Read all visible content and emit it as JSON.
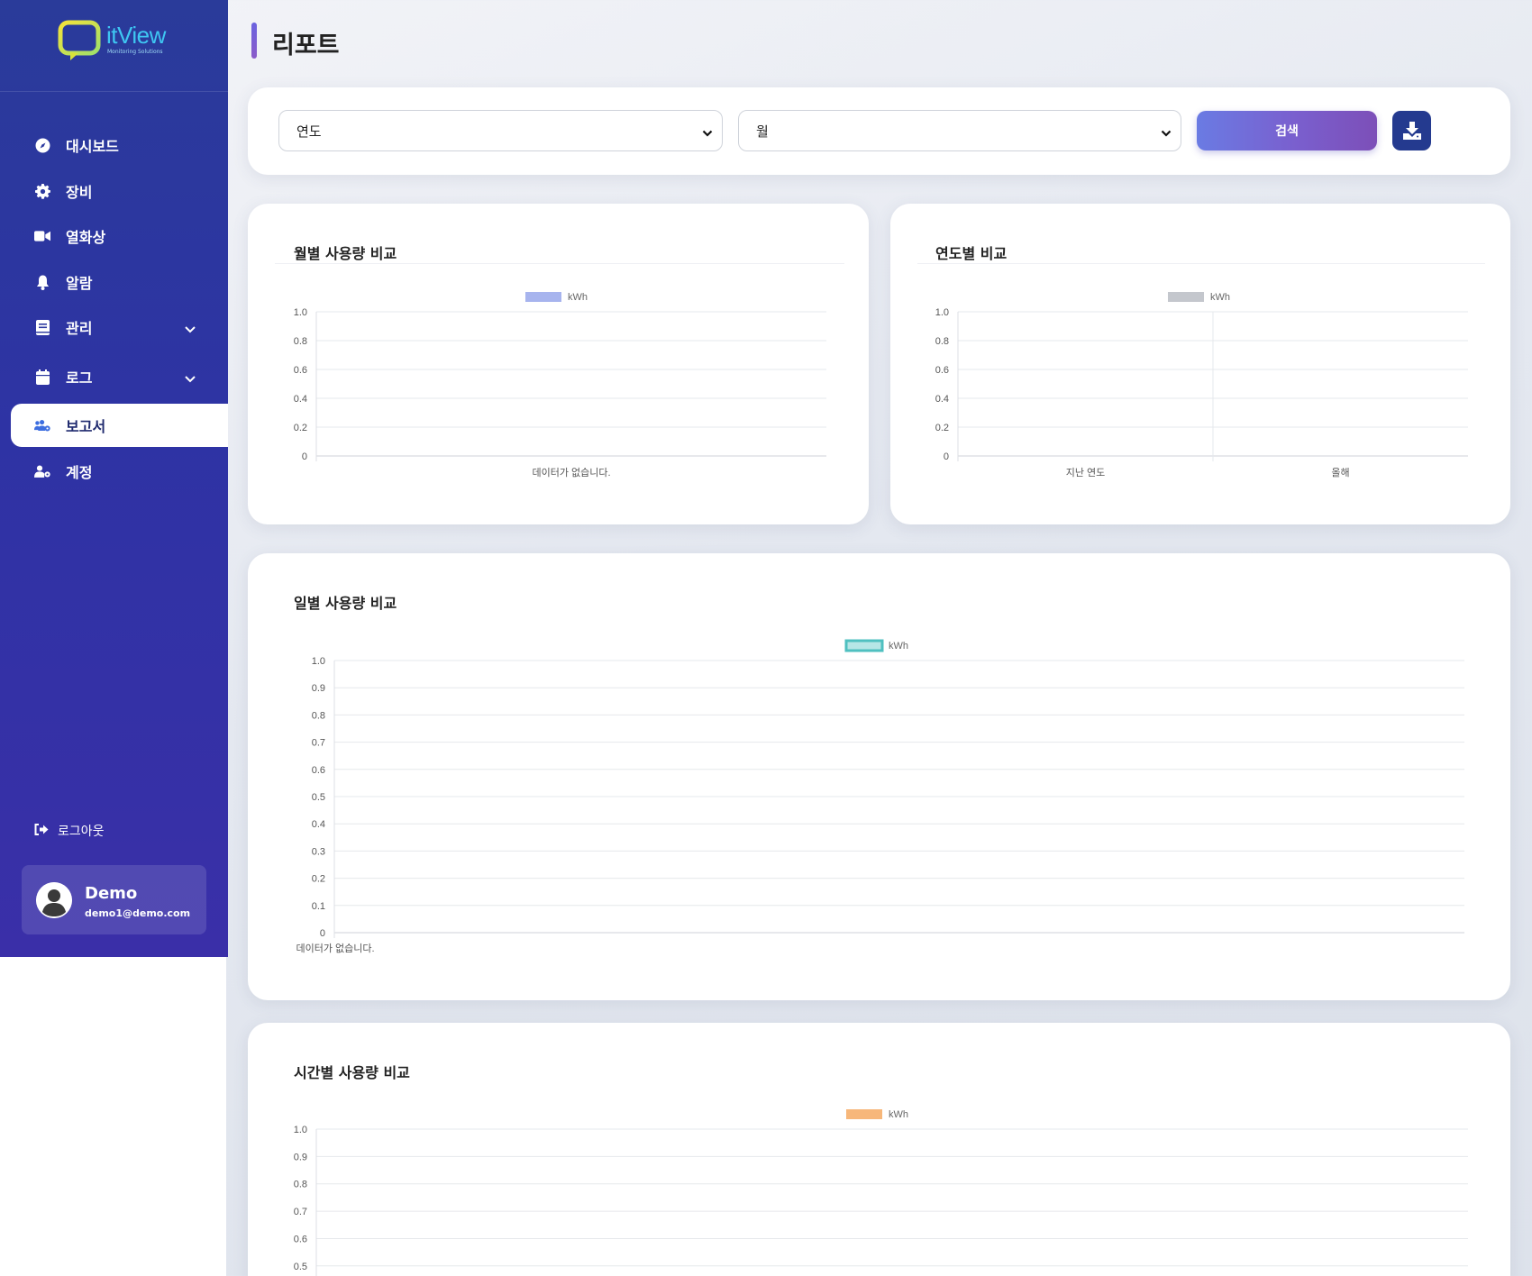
{
  "app": {
    "logo_text": "itView",
    "logo_sub": "Monitoring Solutions"
  },
  "sidebar": {
    "items": [
      {
        "label": "대시보드",
        "icon": "compass-icon"
      },
      {
        "label": "장비",
        "icon": "gear-icon"
      },
      {
        "label": "열화상",
        "icon": "video-camera-icon"
      },
      {
        "label": "알람",
        "icon": "bell-icon"
      },
      {
        "label": "관리",
        "icon": "book-icon"
      },
      {
        "label": "로그",
        "icon": "calendar-icon"
      },
      {
        "label": "보고서",
        "icon": "users-cog-icon"
      },
      {
        "label": "계정",
        "icon": "user-cog-icon"
      }
    ],
    "logout_label": "로그아웃",
    "user": {
      "name": "Demo",
      "email": "demo1@demo.com"
    }
  },
  "header": {
    "title": "리포트"
  },
  "filters": {
    "year_select": "연도",
    "month_select": "월",
    "search_label": "검색"
  },
  "chart_data": [
    {
      "type": "bar",
      "title": "월별 사용량 비교",
      "series": [
        {
          "name": "kWh",
          "values": [],
          "color": "#a7b4ee"
        }
      ],
      "categories": [],
      "y_ticks": [
        "1.0",
        "0.8",
        "0.6",
        "0.4",
        "0.2",
        "0"
      ],
      "ylim": [
        0,
        1.0
      ],
      "empty_label": "데이터가 없습니다.",
      "legend_position": "top"
    },
    {
      "type": "bar",
      "title": "연도별 비교",
      "series": [
        {
          "name": "kWh",
          "values": [],
          "color": "#c4c7cd"
        }
      ],
      "categories": [
        "지난 연도",
        "올해"
      ],
      "y_ticks": [
        "1.0",
        "0.8",
        "0.6",
        "0.4",
        "0.2",
        "0"
      ],
      "ylim": [
        0,
        1.0
      ],
      "legend_position": "top"
    },
    {
      "type": "line",
      "title": "일별 사용량 비교",
      "series": [
        {
          "name": "kWh",
          "values": [],
          "color": "#4fc0c0"
        }
      ],
      "categories": [],
      "y_ticks": [
        "1.0",
        "0.9",
        "0.8",
        "0.7",
        "0.6",
        "0.5",
        "0.4",
        "0.3",
        "0.2",
        "0.1",
        "0"
      ],
      "ylim": [
        0,
        1.0
      ],
      "empty_label": "데이터가 없습니다.",
      "legend_position": "top"
    },
    {
      "type": "bar",
      "title": "시간별 사용량 비교",
      "series": [
        {
          "name": "kWh",
          "values": [],
          "color": "#f7b77a"
        }
      ],
      "categories": [],
      "y_ticks": [
        "1.0",
        "0.9",
        "0.8",
        "0.7",
        "0.6",
        "0.5"
      ],
      "ylim": [
        0,
        1.0
      ],
      "legend_position": "top"
    }
  ]
}
